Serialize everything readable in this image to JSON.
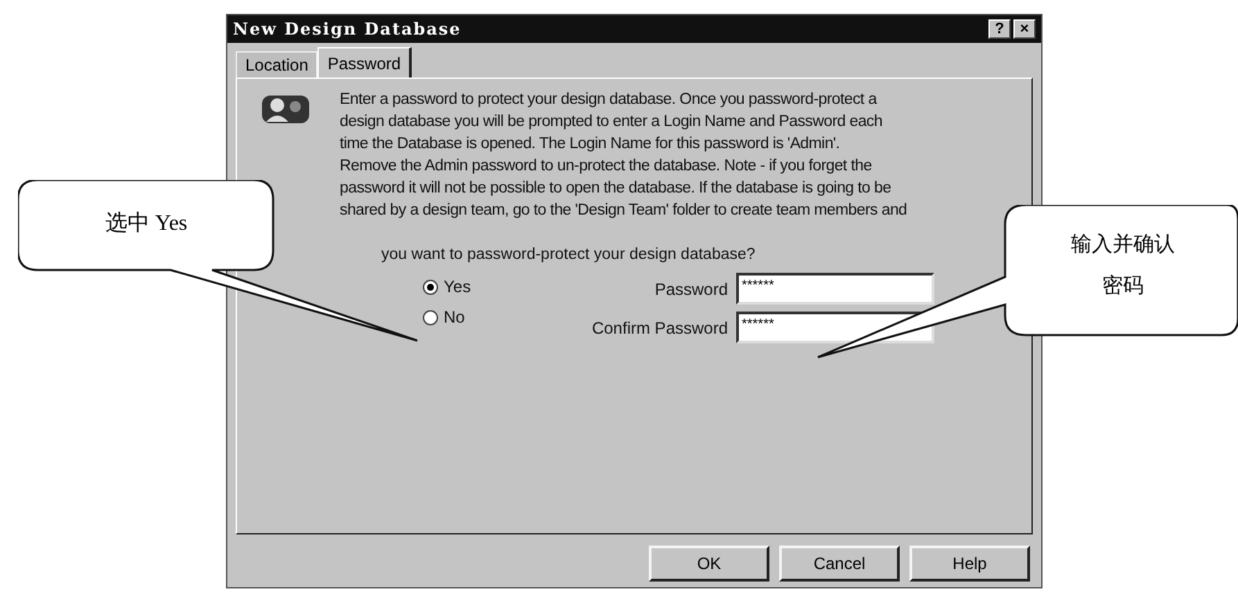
{
  "window": {
    "title": "New Design Database",
    "title_buttons": [
      "?",
      "×"
    ]
  },
  "tabs": [
    {
      "label": "Location",
      "selected": false
    },
    {
      "label": "Password",
      "selected": true
    }
  ],
  "description": "Enter a password to protect your design database. Once you password-protect a\ndesign database you will be prompted to enter a Login Name and Password each\ntime the Database is opened. The Login Name for this password is 'Admin'.\nRemove the Admin password to un-protect the database. Note - if you forget the\npassword it will not be possible to open the database.  If the database is going to be\nshared by a design team, go to the 'Design Team' folder to create team members and",
  "question": "you want to password-protect your design database?",
  "options": [
    {
      "label": "Yes",
      "selected": true
    },
    {
      "label": "No",
      "selected": false
    }
  ],
  "fields": [
    {
      "label": "Password",
      "value": "******"
    },
    {
      "label": "Confirm Password",
      "value": "******"
    }
  ],
  "buttons": [
    "OK",
    "Cancel",
    "Help"
  ],
  "callouts": [
    {
      "kind": "left",
      "text": "选中 Yes"
    },
    {
      "kind": "right",
      "text": "输入并确认密码"
    }
  ]
}
